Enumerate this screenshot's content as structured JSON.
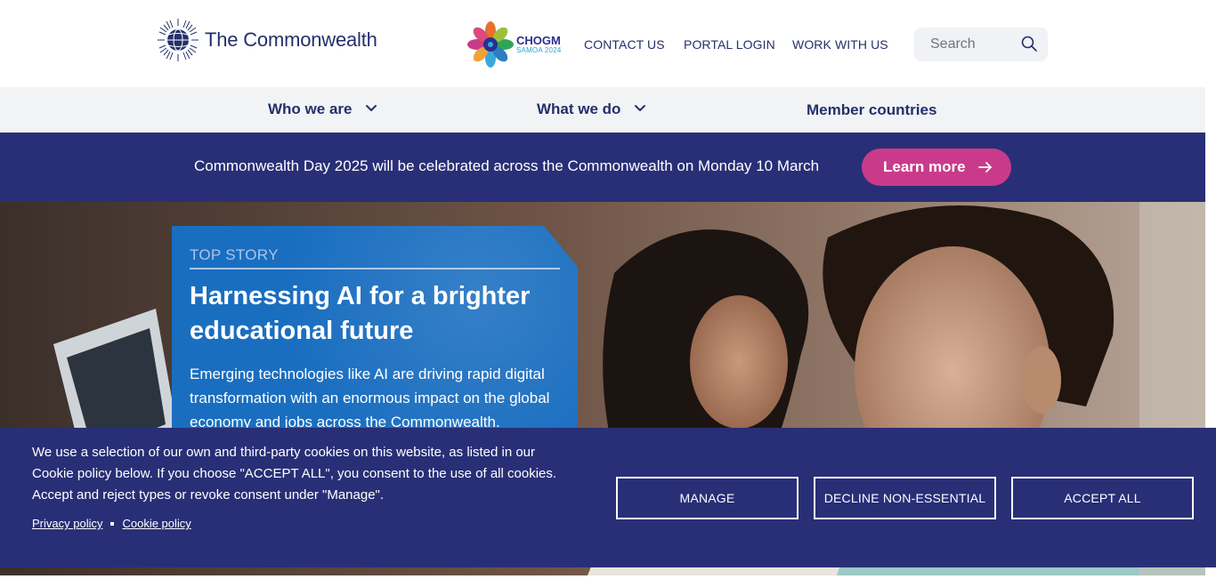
{
  "header": {
    "logo_text": "The Commonwealth",
    "chogm_title": "CHOGM",
    "chogm_subtitle": "SAMOA 2024",
    "links": {
      "contact": "CONTACT US",
      "portal": "PORTAL LOGIN",
      "work": "WORK WITH US"
    },
    "search_placeholder": "Search"
  },
  "main_nav": {
    "who": "Who we are",
    "what": "What we do",
    "member": "Member countries"
  },
  "banner": {
    "text": "Commonwealth Day 2025 will be celebrated across the Commonwealth on Monday 10 March",
    "button": "Learn more"
  },
  "top_story": {
    "label": "TOP STORY",
    "title": "Harnessing AI for a brighter educational future",
    "description": "Emerging technologies like AI are driving rapid digital transformation with an enormous impact on the global economy and jobs across the Commonwealth."
  },
  "cookie": {
    "text": "We use a selection of our own and third-party cookies on this website, as listed in our Cookie policy below. If you choose \"ACCEPT ALL\", you consent to the use of all cookies. Accept and reject types or revoke consent under \"Manage\".",
    "privacy_link": "Privacy policy",
    "cookie_link": "Cookie policy",
    "manage": "MANAGE",
    "decline": "DECLINE NON-ESSENTIAL",
    "accept": "ACCEPT ALL"
  },
  "colors": {
    "brand_navy": "#292f76",
    "text_navy": "#24306b",
    "cta_pink": "#c93b8a",
    "story_blue": "#1a6ec0",
    "nav_bg": "#f1f3f5"
  },
  "icons": [
    "commonwealth-globe-icon",
    "chogm-flower-icon",
    "search-icon",
    "chevron-down-icon",
    "arrow-right-icon"
  ]
}
